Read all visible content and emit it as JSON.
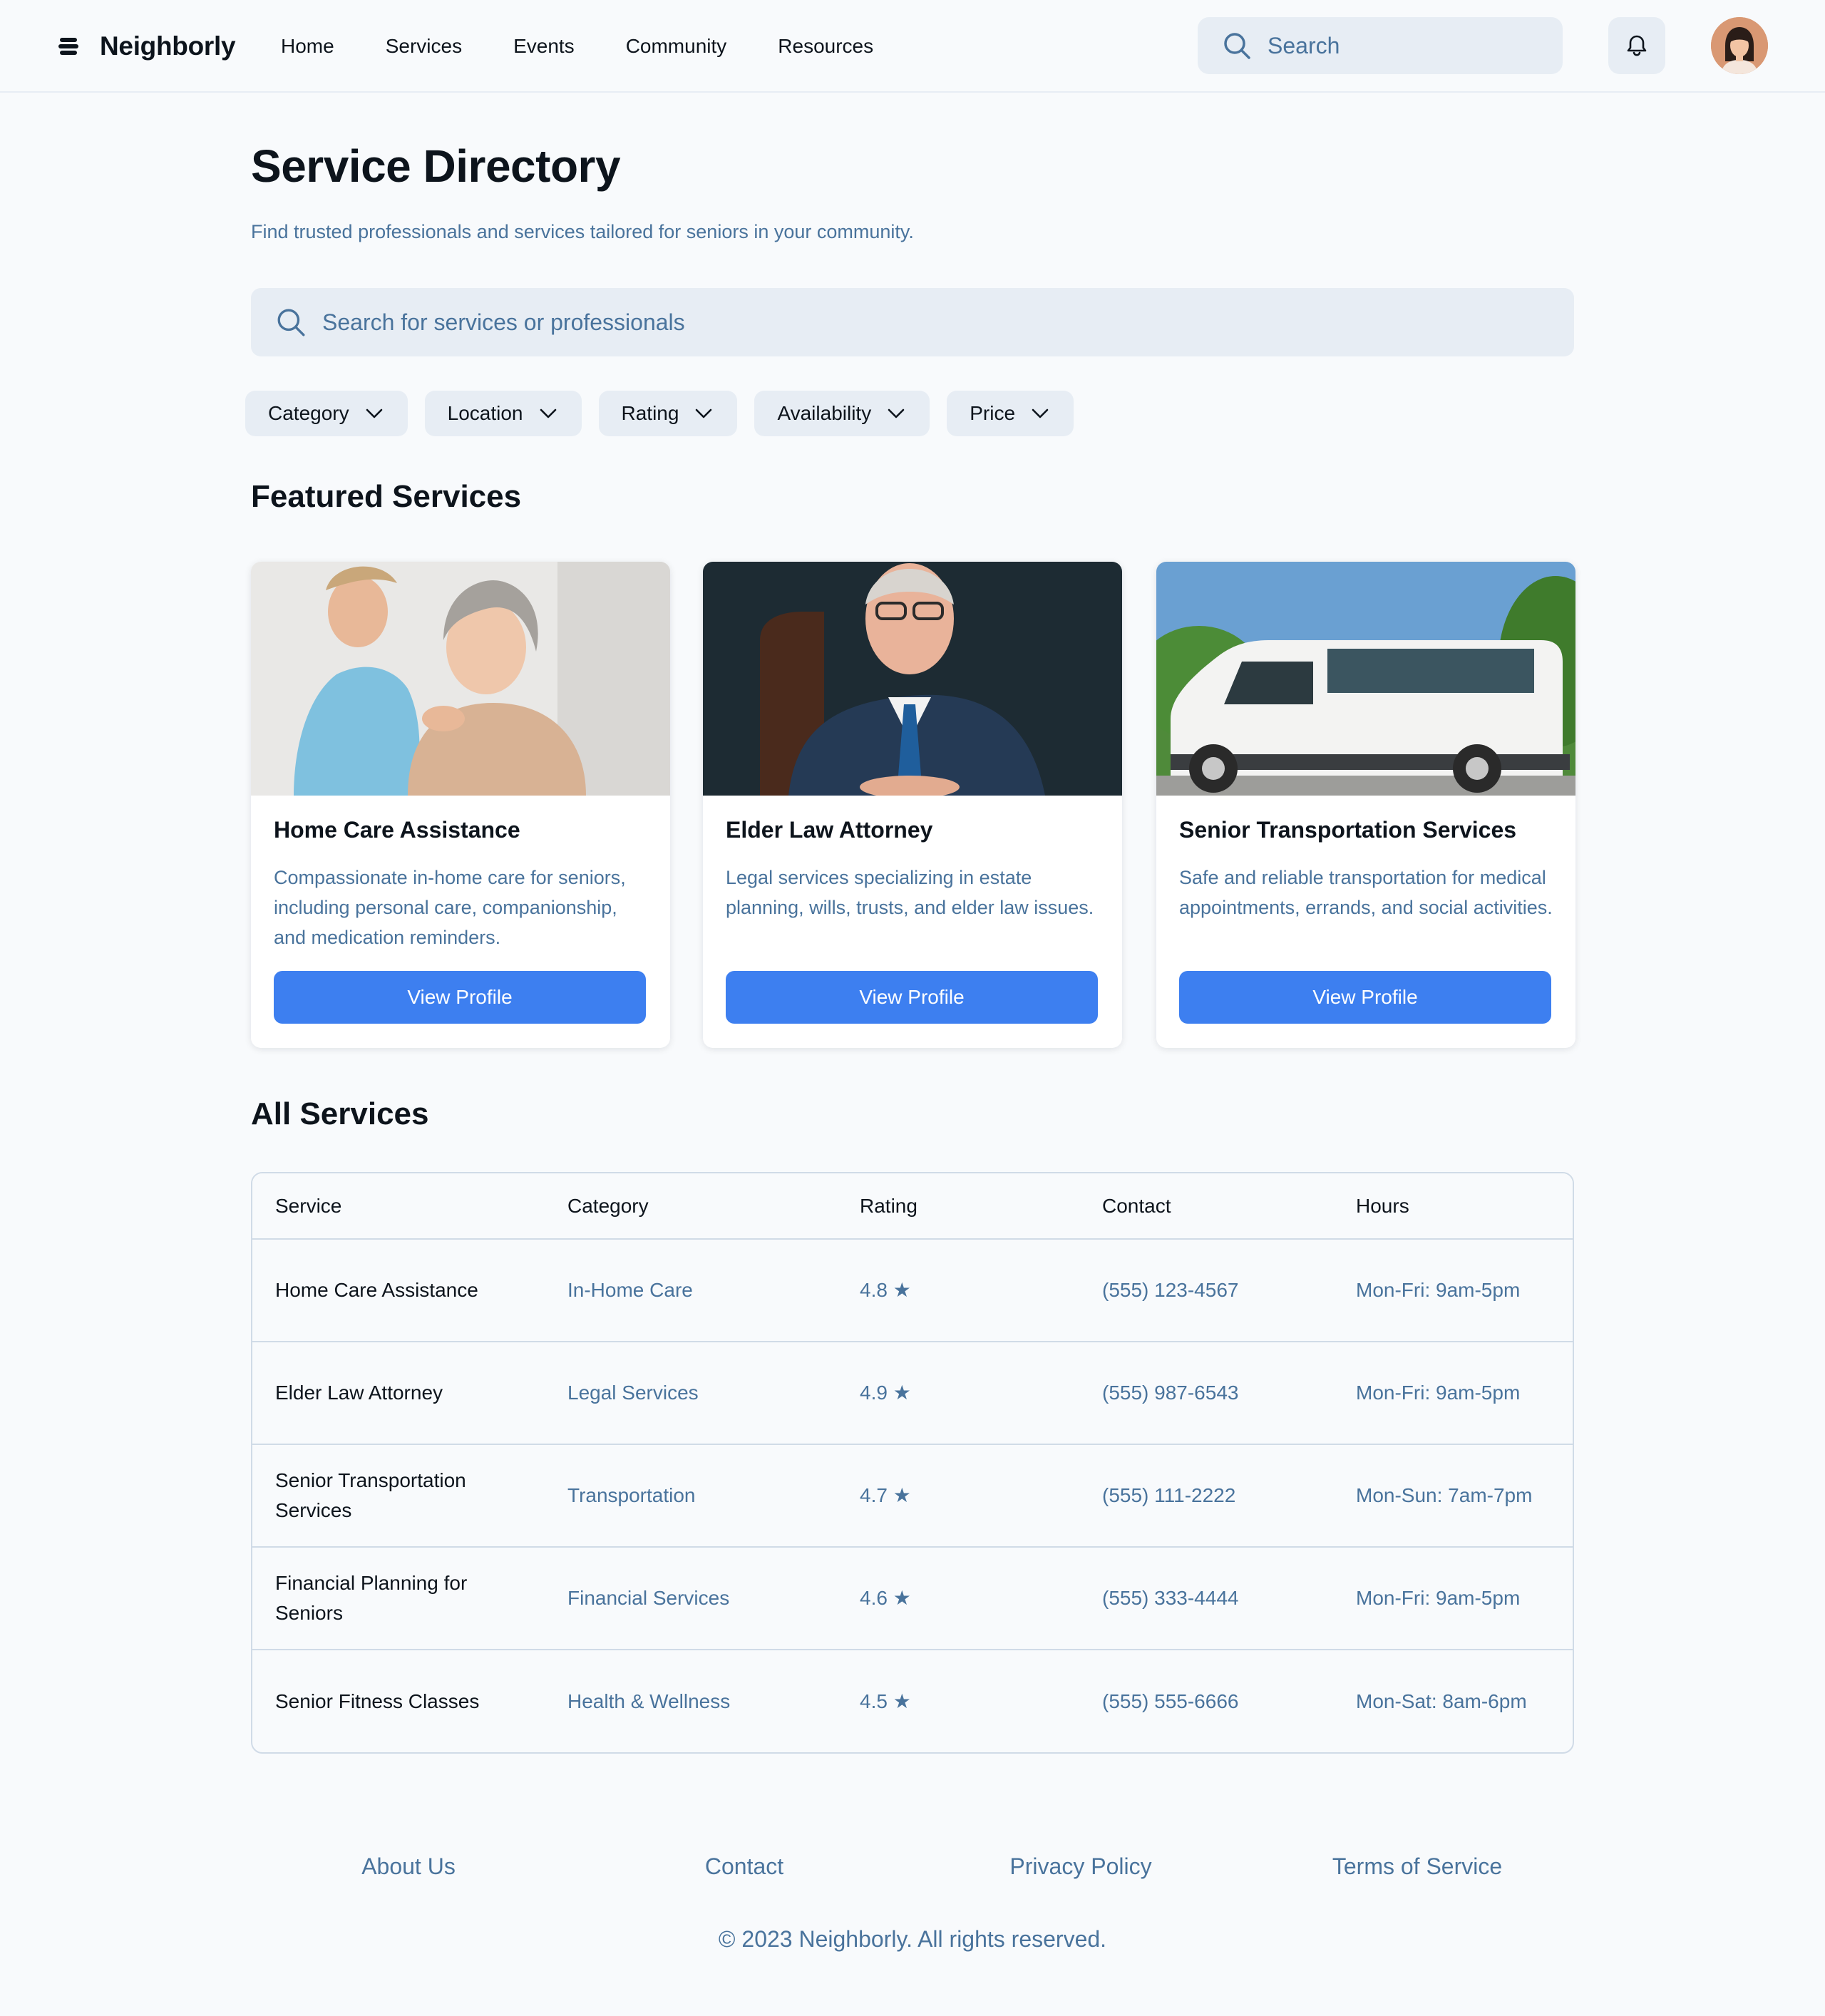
{
  "header": {
    "brand": "Neighborly",
    "nav": [
      "Home",
      "Services",
      "Events",
      "Community",
      "Resources"
    ],
    "search_placeholder": "Search"
  },
  "main": {
    "title": "Service Directory",
    "subtitle": "Find trusted professionals and services tailored for seniors in your community.",
    "search_placeholder": "Search for services or professionals",
    "filters": [
      "Category",
      "Location",
      "Rating",
      "Availability",
      "Price"
    ],
    "featured_title": "Featured Services",
    "featured": [
      {
        "title": "Home Care Assistance",
        "description": "Compassionate in-home care for seniors, including personal care, companionship, and medication reminders.",
        "button": "View Profile"
      },
      {
        "title": "Elder Law Attorney",
        "description": "Legal services specializing in estate planning, wills, trusts, and elder law issues.",
        "button": "View Profile"
      },
      {
        "title": "Senior Transportation Services",
        "description": "Safe and reliable transportation for medical appointments, errands, and social activities.",
        "button": "View Profile"
      }
    ],
    "all_title": "All Services",
    "table": {
      "columns": [
        "Service",
        "Category",
        "Rating",
        "Contact",
        "Hours"
      ],
      "rows": [
        [
          "Home Care Assistance",
          "In-Home Care",
          "4.8 ★",
          "(555) 123-4567",
          "Mon-Fri: 9am-5pm"
        ],
        [
          "Elder Law Attorney",
          "Legal Services",
          "4.9 ★",
          "(555) 987-6543",
          "Mon-Fri: 9am-5pm"
        ],
        [
          "Senior Transportation Services",
          "Transportation",
          "4.7 ★",
          "(555) 111-2222",
          "Mon-Sun: 7am-7pm"
        ],
        [
          "Financial Planning for Seniors",
          "Financial Services",
          "4.6 ★",
          "(555) 333-4444",
          "Mon-Fri: 9am-5pm"
        ],
        [
          "Senior Fitness Classes",
          "Health & Wellness",
          "4.5 ★",
          "(555) 555-6666",
          "Mon-Sat: 8am-6pm"
        ]
      ]
    }
  },
  "footer": {
    "links": [
      "About Us",
      "Contact",
      "Privacy Policy",
      "Terms of Service"
    ],
    "copyright": "© 2023 Neighborly. All rights reserved."
  },
  "colors": {
    "primary": "#3d7ff0",
    "muted_text": "#49739c",
    "surface": "#e7edf4",
    "text": "#0d141c"
  },
  "icons": [
    "logo-icon",
    "search-icon",
    "bell-icon",
    "chevron-down-icon"
  ]
}
